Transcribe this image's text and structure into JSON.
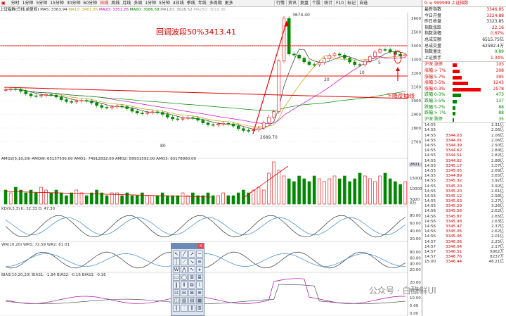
{
  "toolbar": {
    "items": [
      "分时",
      "1分钟",
      "5分钟",
      "15分钟",
      "30分钟",
      "60分钟",
      "日线",
      "周线",
      "月线",
      "多周",
      "1分钟",
      "5分钟",
      "4日线",
      "季线",
      "年线",
      "多周期",
      "更多"
    ],
    "right_buttons": [
      "行情",
      "资讯",
      "复盘",
      "个股",
      "统计",
      "F10",
      "标记",
      "自选"
    ]
  },
  "info": {
    "label": "上证指数(日线,前复权)",
    "ma5": "MA5: 3363.94",
    "ma10": "MA10: 3401.85",
    "ma20": "MA20: 3351.26",
    "ma60": "MA60: 3086.58",
    "ma120": "MA120: 3028.52",
    "ma250": "MA250: 3010.36"
  },
  "annotations": {
    "retrace": "回调波段50%3413.41",
    "support": "下降反抽线",
    "high": "3674.40",
    "low": "2689.70",
    "n80": "80",
    "n20": "20",
    "n10": "10",
    "n5": "5"
  },
  "yaxis": [
    "3600",
    "3500",
    "3400",
    "3300",
    "3200",
    "3100",
    "3000",
    "2900",
    "2800",
    "2700"
  ],
  "current_price": "2601.3",
  "volume": {
    "label": "AMO2(5,10,20) AMOW: 65157536.00 AMO1: 74912832.00 AMO2: 89931592.00 AMO3: 83178960.00",
    "ticks": [
      "15000",
      "10000",
      "5000"
    ],
    "unit": "X万",
    "values": [
      5,
      4,
      6,
      5,
      4,
      5,
      4,
      6,
      5,
      4,
      5,
      4,
      3,
      4,
      5,
      4,
      3,
      4,
      5,
      4,
      3,
      4,
      4,
      3,
      4,
      3,
      3,
      4,
      3,
      3,
      3,
      4,
      3,
      3,
      3,
      4,
      3,
      4,
      3,
      3,
      4,
      3,
      3,
      4,
      3,
      3,
      4,
      5,
      4,
      5,
      6,
      5,
      11,
      15,
      12,
      10,
      9,
      8,
      10,
      9,
      8,
      10,
      9,
      8,
      9,
      10,
      9,
      10,
      8,
      9,
      11,
      10,
      9,
      8,
      10,
      11,
      9,
      8,
      7,
      8
    ]
  },
  "kd": {
    "label": "KD(9,3,3) K: 32.33 D: 47.30",
    "ticks": [
      "80.00",
      "60.00",
      "40.00",
      "20.00"
    ]
  },
  "wr": {
    "label": "WR(10,20) WR1: 72.59 WR2: 61.01",
    "ticks": [
      "80.00",
      "60.00",
      "40.00",
      "20.00"
    ]
  },
  "bias": {
    "label": "BIAS(10,20,20) BIAS1: -1.84 BIAS2: -0.16 BIAS3: -0.16",
    "ticks": [
      "20.00",
      "15.00",
      "10.00",
      "5.00",
      "0.00"
    ]
  },
  "right_panel": {
    "header": "G ≡ 999999 上证指数",
    "rows": [
      {
        "k": "最新指数",
        "v": "3346.85",
        "c": "red"
      },
      {
        "k": "今日开盘",
        "v": "3324.88",
        "c": "red"
      },
      {
        "k": "昨日收盘",
        "v": "3323.85",
        "c": ""
      },
      {
        "k": "指数涨跌",
        "v": "22.16",
        "c": "red"
      },
      {
        "k": "指数涨幅",
        "v": "0.67%",
        "c": "red"
      },
      {
        "k": "总成交额",
        "v": "6515.75亿",
        "c": ""
      },
      {
        "k": "总成交量",
        "v": "62582.4万",
        "c": ""
      },
      {
        "k": "指数量比",
        "v": "0.89",
        "c": "grn"
      },
      {
        "k": "上证换手",
        "v": "1.34%",
        "c": "red"
      }
    ],
    "stats": [
      {
        "k": "沪深 涨停",
        "v": "103",
        "c": "red",
        "w": 6
      },
      {
        "k": "涨幅 > 7%",
        "v": "308",
        "c": "red",
        "w": 10
      },
      {
        "k": "涨幅 5-7%",
        "v": "395",
        "c": "red",
        "w": 13
      },
      {
        "k": "涨幅 3-5%",
        "v": "1243",
        "c": "red",
        "w": 22
      },
      {
        "k": "涨幅 0-3%",
        "v": "2578",
        "c": "red",
        "w": 40
      },
      {
        "k": "跌幅 0-3%",
        "v": "473",
        "c": "grn",
        "w": 12
      },
      {
        "k": "跌幅 3-5%",
        "v": "137",
        "c": "grn",
        "w": 6
      },
      {
        "k": "跌幅 5-7%",
        "v": "88",
        "c": "grn",
        "w": 4
      },
      {
        "k": "跌幅 > 7%",
        "v": "88",
        "c": "grn",
        "w": 4
      },
      {
        "k": "沪深 跌停",
        "v": "35",
        "c": "grn",
        "w": 2
      }
    ],
    "ticks": [
      {
        "t": "14:55",
        "p": "",
        "v": "2.31亿"
      },
      {
        "t": "14:55",
        "p": "",
        "v": "2.06亿"
      },
      {
        "t": "14:55",
        "p": "3344.03",
        "v": "2.06亿"
      },
      {
        "t": "14:55",
        "p": "3344.01",
        "v": "2.06亿"
      },
      {
        "t": "14:55",
        "p": "3344.39",
        "v": "2.50亿"
      },
      {
        "t": "14:55",
        "p": "3344.62",
        "v": "2.84亿"
      },
      {
        "t": "14:55",
        "p": "3344.51",
        "v": "2.82亿"
      },
      {
        "t": "14:55",
        "p": "3344.62",
        "v": "2.88亿"
      },
      {
        "t": "14:55",
        "p": "3345.17",
        "v": "3.07亿"
      },
      {
        "t": "14:55",
        "p": "3345.05",
        "v": "2.69亿"
      },
      {
        "t": "14:55",
        "p": "3344.89",
        "v": "3.65亿"
      },
      {
        "t": "14:55",
        "p": "3345.32",
        "v": "3.92亿"
      },
      {
        "t": "14:55",
        "p": "3345.20",
        "v": "3.92亿"
      },
      {
        "t": "14:55",
        "p": "3345.20",
        "v": "2.61亿"
      },
      {
        "t": "14:55",
        "p": "3345.12",
        "v": "2.58亿"
      },
      {
        "t": "14:55",
        "p": "3345.63",
        "v": "2.27亿"
      },
      {
        "t": "14:55",
        "p": "3345.29",
        "v": "3.26亿"
      },
      {
        "t": "14:56",
        "p": "3345.56",
        "v": "2.62亿"
      },
      {
        "t": "14:56",
        "p": "3345.87",
        "v": "2.65亿"
      },
      {
        "t": "14:56",
        "p": "3345.98",
        "v": "2.63亿"
      },
      {
        "t": "14:56",
        "p": "3345.47",
        "v": "2.37亿"
      },
      {
        "t": "14:56",
        "p": "3345.06",
        "v": "2.62亿"
      },
      {
        "t": "14:56",
        "p": "3345.06",
        "v": "2.01亿"
      },
      {
        "t": "14:57",
        "p": "3346.06",
        "v": "2.25亿"
      },
      {
        "t": "14:57",
        "p": "3346.04",
        "v": "2.17亿"
      },
      {
        "t": "14:57",
        "p": "3346.51",
        "v": "5862万"
      },
      {
        "t": "14:57",
        "p": "3346.76",
        "v": "8237万"
      },
      {
        "t": "15:00",
        "p": "3346.44",
        "v": "48.21亿"
      }
    ]
  },
  "watermark": "公众号 · 白醋鲜UI"
}
